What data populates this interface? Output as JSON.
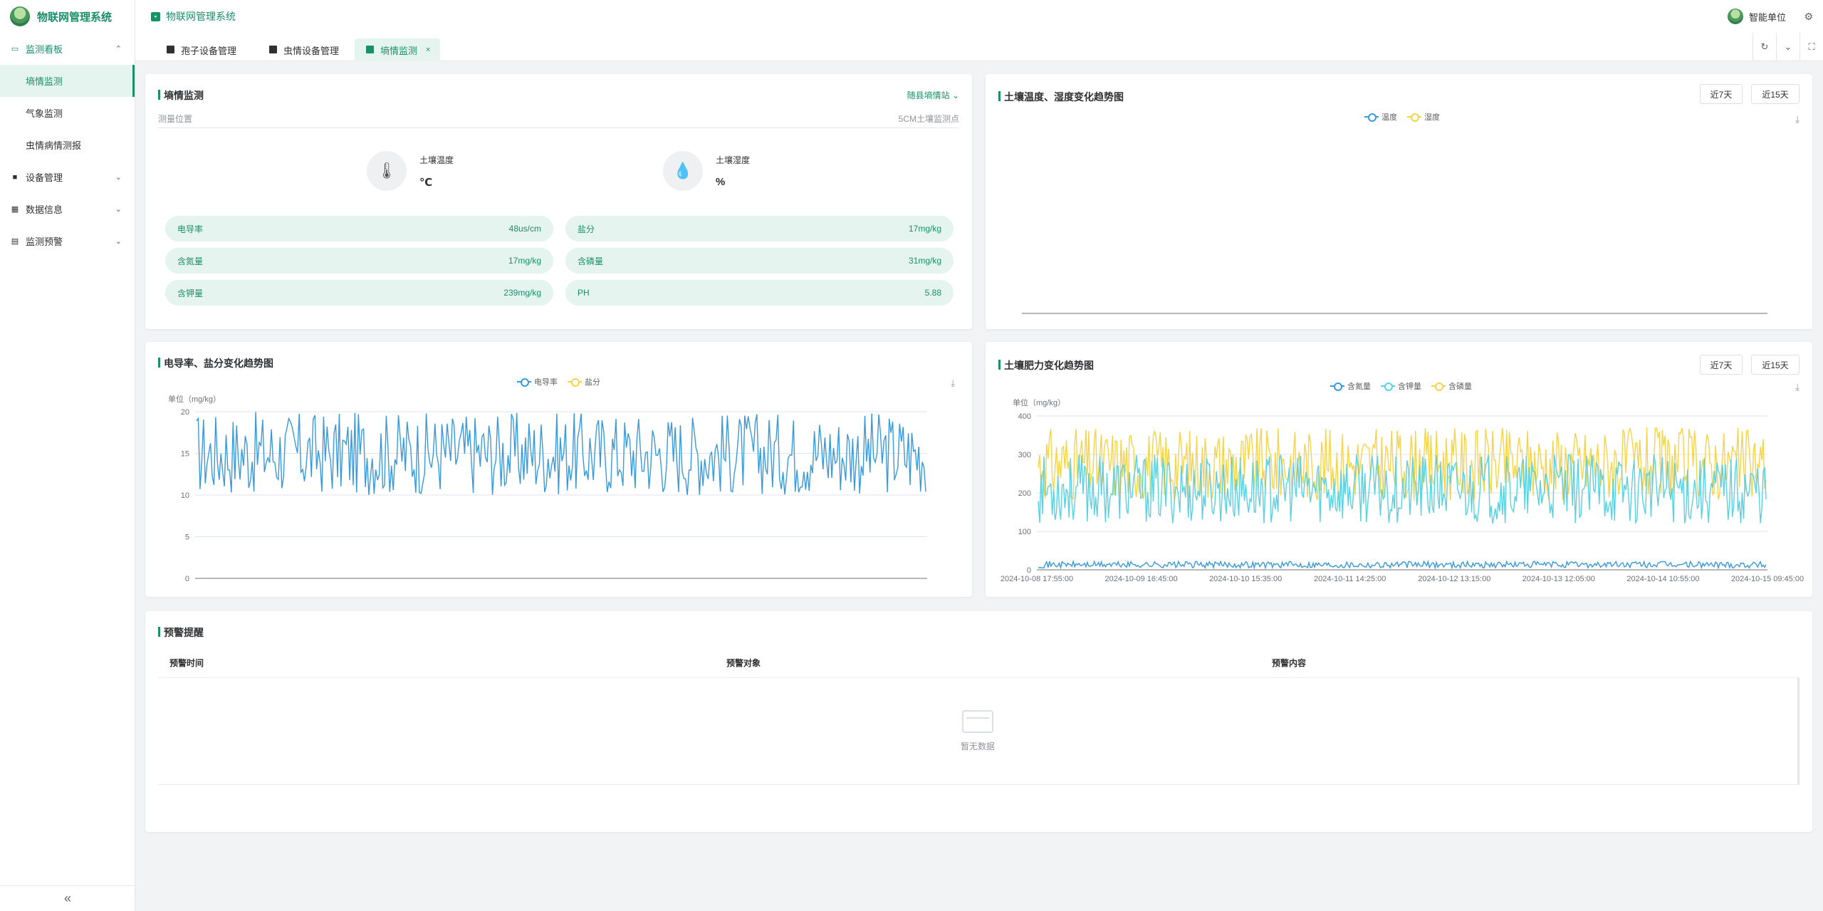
{
  "app": {
    "title": "物联网管理系统",
    "header_title": "物联网管理系统",
    "user": "智能单位"
  },
  "sidebar": {
    "monitor_board": "监测看板",
    "sub": [
      "墒情监测",
      "气象监测",
      "虫情病情测报"
    ],
    "items": [
      "设备管理",
      "数据信息",
      "监测预警"
    ]
  },
  "tabs": [
    {
      "label": "孢子设备管理"
    },
    {
      "label": "虫情设备管理"
    },
    {
      "label": "墒情监测",
      "active": true
    }
  ],
  "soil": {
    "title": "墒情监测",
    "station": "随县墒情站",
    "location_label": "测量位置",
    "location_value": "5CM土壤监测点",
    "temp_label": "土壤温度",
    "temp_unit": "℃",
    "humidity_label": "土壤湿度",
    "humidity_unit": "%",
    "metrics": [
      {
        "name": "电导率",
        "value": "48us/cm"
      },
      {
        "name": "盐分",
        "value": "17mg/kg"
      },
      {
        "name": "含氮量",
        "value": "17mg/kg"
      },
      {
        "name": "含磷量",
        "value": "31mg/kg"
      },
      {
        "name": "含钾量",
        "value": "239mg/kg"
      },
      {
        "name": "PH",
        "value": "5.88"
      }
    ]
  },
  "buttons": {
    "d7": "近7天",
    "d15": "近15天"
  },
  "alerts": {
    "title": "预警提醒",
    "columns": [
      "预警时间",
      "预警对象",
      "预警内容"
    ],
    "empty": "暂无数据"
  },
  "colors": {
    "accent": "#1a8f68",
    "blue": "#3a9ad9",
    "yellow": "#f5d448",
    "cyan": "#5ad1e0"
  },
  "chart_data": [
    {
      "type": "line",
      "title": "土壤温度、湿度变化趋势图",
      "legend": [
        "温度",
        "湿度"
      ],
      "series": [
        {
          "name": "温度",
          "values": []
        },
        {
          "name": "湿度",
          "values": []
        }
      ]
    },
    {
      "type": "line",
      "title": "电导率、盐分变化趋势图",
      "ylabel": "单位（mg/kg）",
      "ylim": [
        0,
        20
      ],
      "yticks": [
        0,
        5,
        10,
        15,
        20
      ],
      "legend": [
        "电导率",
        "盐分"
      ],
      "series": [
        {
          "name": "电导率",
          "range": [
            10,
            20
          ]
        },
        {
          "name": "盐分",
          "values": []
        }
      ]
    },
    {
      "type": "line",
      "title": "土壤肥力变化趋势图",
      "ylabel": "单位（mg/kg）",
      "ylim": [
        0,
        400
      ],
      "yticks": [
        0,
        100,
        200,
        300,
        400
      ],
      "legend": [
        "含氮量",
        "含钾量",
        "含磷量"
      ],
      "x_labels": [
        "2024-10-08 17:55:00",
        "2024-10-09 16:45:00",
        "2024-10-10 15:35:00",
        "2024-10-11 14:25:00",
        "2024-10-12 13:15:00",
        "2024-10-13 12:05:00",
        "2024-10-14 10:55:00",
        "2024-10-15 09:45:00"
      ],
      "series": [
        {
          "name": "含磷量",
          "range": [
            180,
            370
          ]
        },
        {
          "name": "含钾量",
          "range": [
            120,
            300
          ]
        },
        {
          "name": "含氮量",
          "range": [
            5,
            22
          ]
        }
      ]
    }
  ]
}
